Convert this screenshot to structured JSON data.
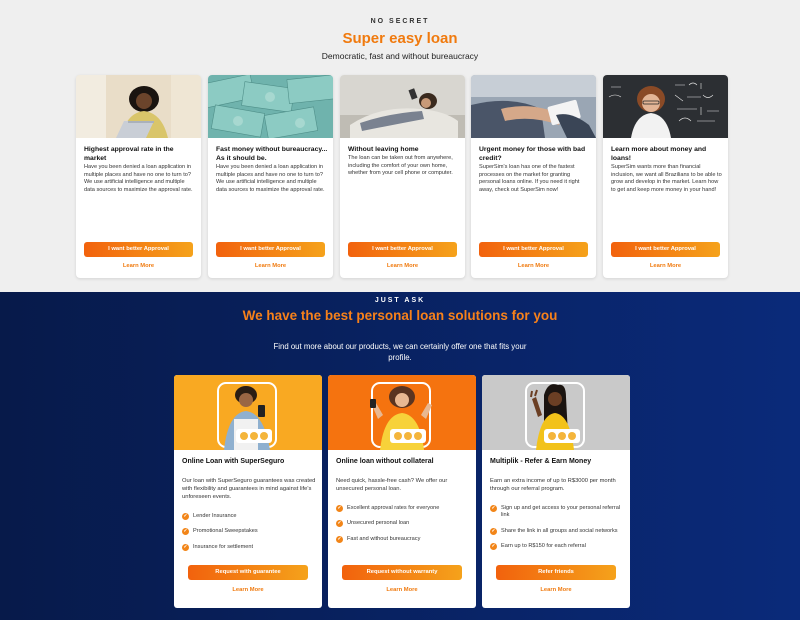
{
  "section1": {
    "eyebrow": "NO SECRET",
    "title": "Super easy loan",
    "subtitle": "Democratic, fast and without bureaucracy",
    "cards": [
      {
        "title": "Highest approval rate in the market",
        "text": "Have you been denied a loan application in multiple places and have no one to turn to? We use artificial intelligence and multiple data sources to maximize the approval rate.",
        "button": "I want better Approval",
        "link": "Learn More"
      },
      {
        "title": "Fast money without bureaucracy... As it should be.",
        "text": "Have you been denied a loan application in multiple places and have no one to turn to? We use artificial intelligence and multiple data sources to maximize the approval rate.",
        "button": "I want better Approval",
        "link": "Learn More"
      },
      {
        "title": "Without leaving home",
        "text": "The loan can be taken out from anywhere, including the comfort of your own home, whether from your cell phone or computer.",
        "button": "I want better Approval",
        "link": "Learn More"
      },
      {
        "title": "Urgent money for those with bad credit?",
        "text": "SuperSim's loan has one of the fastest processes on the market for granting personal loans online. If you need it right away, check out SuperSim now!",
        "button": "I want better Approval",
        "link": "Learn More"
      },
      {
        "title": "Learn more about money and loans!",
        "text": "SuperSim wants more than financial inclusion, we want all Brazilians to be able to grow and develop in the market. Learn how to get and keep more money in your hand!",
        "button": "I want better Approval",
        "link": "Learn More"
      }
    ]
  },
  "section2": {
    "eyebrow": "JUST ASK",
    "title": "We have the best personal loan solutions for you",
    "subtitle": "Find out more about our products, we can certainly offer one that fits your profile.",
    "products": [
      {
        "title": "Online Loan with SuperSeguro",
        "text": "Our loan with SuperSeguro guarantees was created with flexibility and guarantees in mind against life's unforeseen events.",
        "features": [
          "Lender Insurance",
          "Promotional Sweepstakes",
          "Insurance for settlement"
        ],
        "button": "Request with guarantee",
        "link": "Learn More",
        "bg": "#f9a922"
      },
      {
        "title": "Online loan without collateral",
        "text": "Need quick, hassle-free cash? We offer our unsecured personal loan.",
        "features": [
          "Excellent approval rates for everyone",
          "Unsecured personal loan",
          "Fast and without bureaucracy"
        ],
        "button": "Request without warranty",
        "link": "Learn More",
        "bg": "#f5730f"
      },
      {
        "title": "Multiplik - Refer & Earn Money",
        "text": "Earn an extra income of up to R$3000 per month through our referral program.",
        "features": [
          "Sign up and get access to your personal referral link",
          "Share the link in all groups and social networks",
          "Earn up to R$150 for each referral"
        ],
        "button": "Refer friends",
        "link": "Learn More",
        "bg": "#c9c9c9"
      }
    ]
  },
  "colors": {
    "accent": "#f07a0e",
    "navy": "#071a4a",
    "check": "#f28518"
  }
}
